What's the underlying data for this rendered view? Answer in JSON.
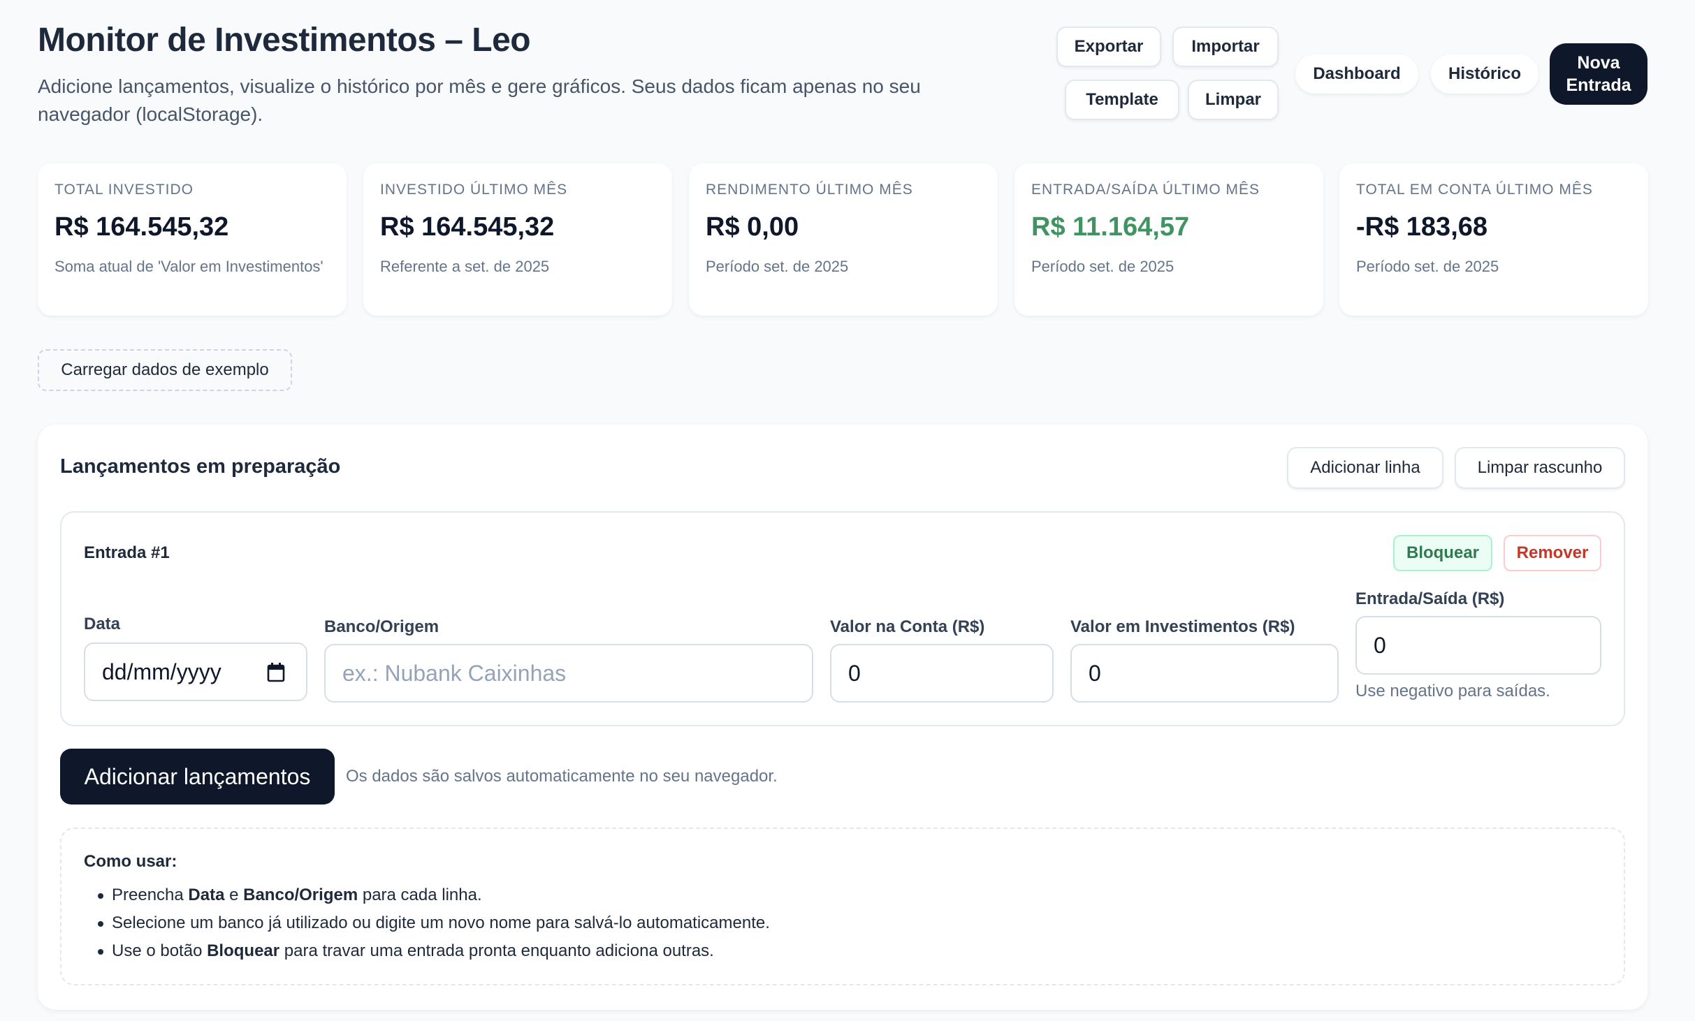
{
  "header": {
    "title": "Monitor de Investimentos – Leo",
    "subtitle": "Adicione lançamentos, visualize o histórico por mês e gere gráficos. Seus dados ficam apenas no seu navegador (localStorage).",
    "buttons": {
      "export": "Exportar",
      "import": "Importar",
      "template": "Template",
      "clear": "Limpar"
    },
    "nav": {
      "dashboard": "Dashboard",
      "history": "Histórico",
      "new_entry": "Nova Entrada"
    }
  },
  "stats": [
    {
      "label": "TOTAL INVESTIDO",
      "value": "R$ 164.545,32",
      "note": "Soma atual de 'Valor em Investimentos'"
    },
    {
      "label": "INVESTIDO ÚLTIMO MÊS",
      "value": "R$ 164.545,32",
      "note": "Referente a set. de 2025"
    },
    {
      "label": "RENDIMENTO ÚLTIMO MÊS",
      "value": "R$ 0,00",
      "note": "Período set. de 2025"
    },
    {
      "label": "ENTRADA/SAÍDA ÚLTIMO MÊS",
      "value": "R$ 11.164,57",
      "note": "Período set. de 2025",
      "color": "#3f9462"
    },
    {
      "label": "TOTAL EM CONTA ÚLTIMO MÊS",
      "value": "-R$ 183,68",
      "note": "Período set. de 2025"
    }
  ],
  "load_example": "Carregar dados de exemplo",
  "draft": {
    "title": "Lançamentos em preparação",
    "add_row": "Adicionar linha",
    "clear_draft": "Limpar rascunho",
    "entry": {
      "title": "Entrada #1",
      "lock": "Bloquear",
      "remove": "Remover",
      "fields": {
        "date_label": "Data",
        "date_value": "dd/mm/yyyy",
        "bank_label": "Banco/Origem",
        "bank_placeholder": "ex.: Nubank Caixinhas",
        "account_label": "Valor na Conta (R$)",
        "account_value": "0",
        "invest_label": "Valor em Investimentos (R$)",
        "invest_value": "0",
        "flow_label": "Entrada/Saída (R$)",
        "flow_value": "0",
        "flow_hint": "Use negativo para saídas."
      }
    },
    "submit": "Adicionar lançamentos",
    "autosave_note": "Os dados são salvos automaticamente no seu navegador."
  },
  "howto": {
    "title": "Como usar:",
    "items": [
      {
        "pre": "Preencha ",
        "b1": "Data",
        "mid": " e ",
        "b2": "Banco/Origem",
        "post": " para cada linha."
      },
      {
        "text": "Selecione um banco já utilizado ou digite um novo nome para salvá-lo automaticamente."
      },
      {
        "pre": "Use o botão ",
        "b1": "Bloquear",
        "post": " para travar uma entrada pronta enquanto adiciona outras."
      }
    ]
  },
  "colors": {
    "accent_dark": "#0f172a",
    "positive": "#3f9462",
    "danger": "#c0392b"
  }
}
